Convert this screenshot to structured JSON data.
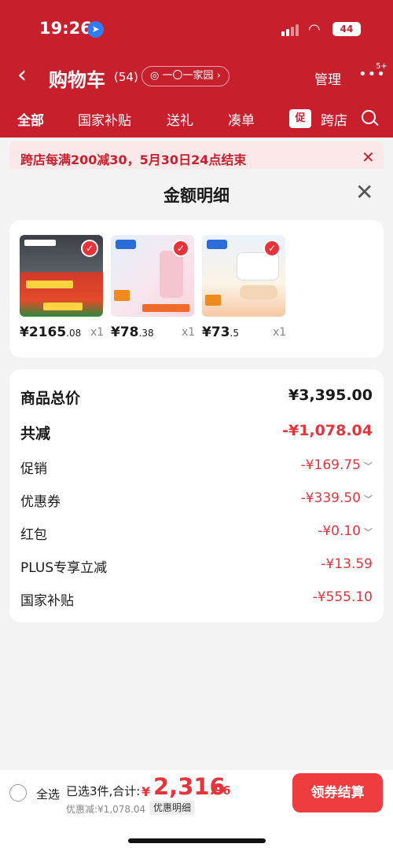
{
  "status": {
    "time": "19:26",
    "battery": "44"
  },
  "cart": {
    "title": "购物车",
    "count": "(54)",
    "address": "一〇一家园",
    "manage": "管理",
    "more_badge": "5+",
    "tabs": [
      "全部",
      "国家补贴",
      "送礼",
      "凑单",
      "跨店"
    ],
    "promo_tag": "促",
    "promo_banner": "跨店每满200减30，5月30日24点结束"
  },
  "sheet": {
    "title": "金额明细",
    "products": [
      {
        "price": "¥2165",
        "cents": ".08",
        "qty": "x1"
      },
      {
        "price": "¥78",
        "cents": ".38",
        "qty": "x1"
      },
      {
        "price": "¥73",
        "cents": ".5",
        "qty": "x1"
      }
    ],
    "breakdown": [
      {
        "label": "商品总价",
        "value": "¥3,395.00"
      },
      {
        "label": "共减",
        "value": "-¥1,078.04"
      },
      {
        "label": "促销",
        "value": "-¥169.75"
      },
      {
        "label": "优惠券",
        "value": "-¥339.50"
      },
      {
        "label": "红包",
        "value": "-¥0.10"
      },
      {
        "label": "PLUS专享立减",
        "value": "-¥13.59"
      },
      {
        "label": "国家补贴",
        "value": "-¥555.10"
      }
    ]
  },
  "bottom": {
    "select_all": "全选",
    "selected_info": "已选3件,合计:",
    "total_yen": "¥",
    "total_main": "2,316",
    "total_cents": ".96",
    "discount_line": "优惠减:¥1,078.04",
    "detail_pill": "优惠明细",
    "checkout": "领券结算"
  },
  "colors": {
    "brand_red": "#c81f2d",
    "accent_red": "#e8333b",
    "button_red": "#f03b3f"
  }
}
